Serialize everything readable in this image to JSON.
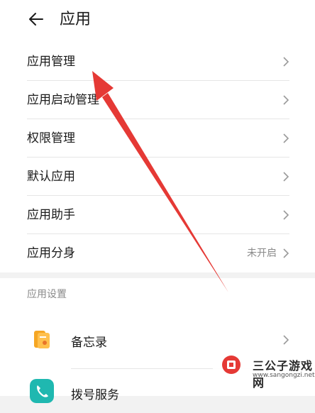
{
  "header": {
    "title": "应用",
    "back_icon": "arrow-left-icon"
  },
  "menu": {
    "items": [
      {
        "label": "应用管理",
        "icon": "chevron-right-icon"
      },
      {
        "label": "应用启动管理",
        "icon": "chevron-right-icon"
      },
      {
        "label": "权限管理",
        "icon": "chevron-right-icon"
      },
      {
        "label": "默认应用",
        "icon": "chevron-right-icon"
      },
      {
        "label": "应用助手",
        "icon": "chevron-right-icon"
      },
      {
        "label": "应用分身",
        "status": "未开启",
        "icon": "chevron-right-icon"
      }
    ]
  },
  "app_settings": {
    "section_label": "应用设置",
    "apps": [
      {
        "name": "备忘录",
        "icon": "notepad-icon",
        "color": "#f5a623"
      },
      {
        "name": "拨号服务",
        "icon": "phone-icon",
        "color": "#1fb8b0"
      }
    ]
  },
  "watermark": {
    "title": "三公子游戏网",
    "url": "www.sangongzi.net",
    "colors": {
      "logo": "#e53935"
    }
  },
  "colors": {
    "accent_arrow": "#e53935",
    "background": "#f2f2f2"
  }
}
